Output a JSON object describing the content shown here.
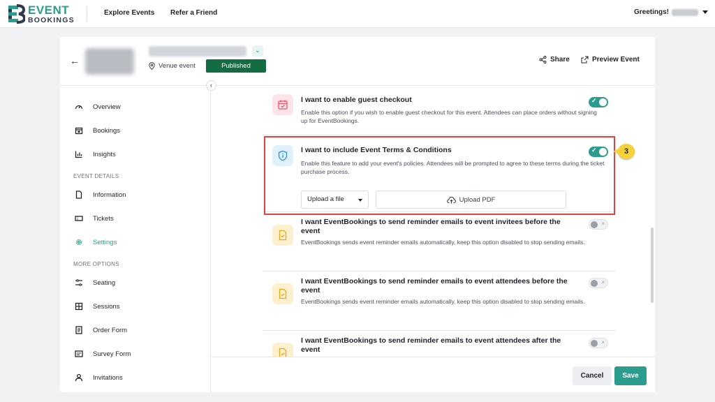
{
  "brand": {
    "line1": "EVENT",
    "line2": "BOOKINGS",
    "accent": "#2a9d8f"
  },
  "topnav": {
    "explore": "Explore Events",
    "refer": "Refer a Friend",
    "greeting": "Greetings!"
  },
  "event": {
    "venue_label": "Venue event",
    "status": "Published",
    "share": "Share",
    "preview": "Preview Event"
  },
  "sidebar": {
    "items": [
      {
        "label": "Overview",
        "icon": "gauge-icon"
      },
      {
        "label": "Bookings",
        "icon": "calendar-icon"
      },
      {
        "label": "Insights",
        "icon": "bar-chart-icon"
      }
    ],
    "group_details": "EVENT DETAILS",
    "details": [
      {
        "label": "Information",
        "icon": "document-icon"
      },
      {
        "label": "Tickets",
        "icon": "ticket-icon"
      },
      {
        "label": "Settings",
        "icon": "gear-icon",
        "active": true
      }
    ],
    "group_more": "MORE OPTIONS",
    "more": [
      {
        "label": "Seating",
        "icon": "sliders-icon"
      },
      {
        "label": "Sessions",
        "icon": "grid-icon"
      },
      {
        "label": "Order Form",
        "icon": "form-icon"
      },
      {
        "label": "Survey Form",
        "icon": "survey-icon"
      },
      {
        "label": "Invitations",
        "icon": "user-icon"
      }
    ]
  },
  "settings": [
    {
      "title": "I want to enable guest checkout",
      "desc": "Enable this option if you wish to enable guest checkout for this event. Attendees can place orders without signing up for EventBookings.",
      "enabled": true
    },
    {
      "title": "I want to include Event Terms & Conditions",
      "desc": "Enable this feature to add your event's policies. Attendees will be prompted to agree to these terms during the ticket purchase process.",
      "enabled": true,
      "upload_select": "Upload a file",
      "upload_pdf": "Upload PDF"
    },
    {
      "title": "I want EventBookings to send reminder emails to event invitees before the event",
      "desc": "EventBookings sends event reminder emails automatically, keep this option disabled to stop sending emails.",
      "enabled": false
    },
    {
      "title": "I want EventBookings to send reminder emails to event attendees before the event",
      "desc": "EventBookings sends event reminder emails automatically, keep this option disabled to stop sending emails.",
      "enabled": false
    },
    {
      "title": "I want EventBookings to send reminder emails to event attendees after the event",
      "desc": "",
      "enabled": false
    }
  ],
  "annotation": {
    "step": "3"
  },
  "footer": {
    "cancel": "Cancel",
    "save": "Save"
  }
}
